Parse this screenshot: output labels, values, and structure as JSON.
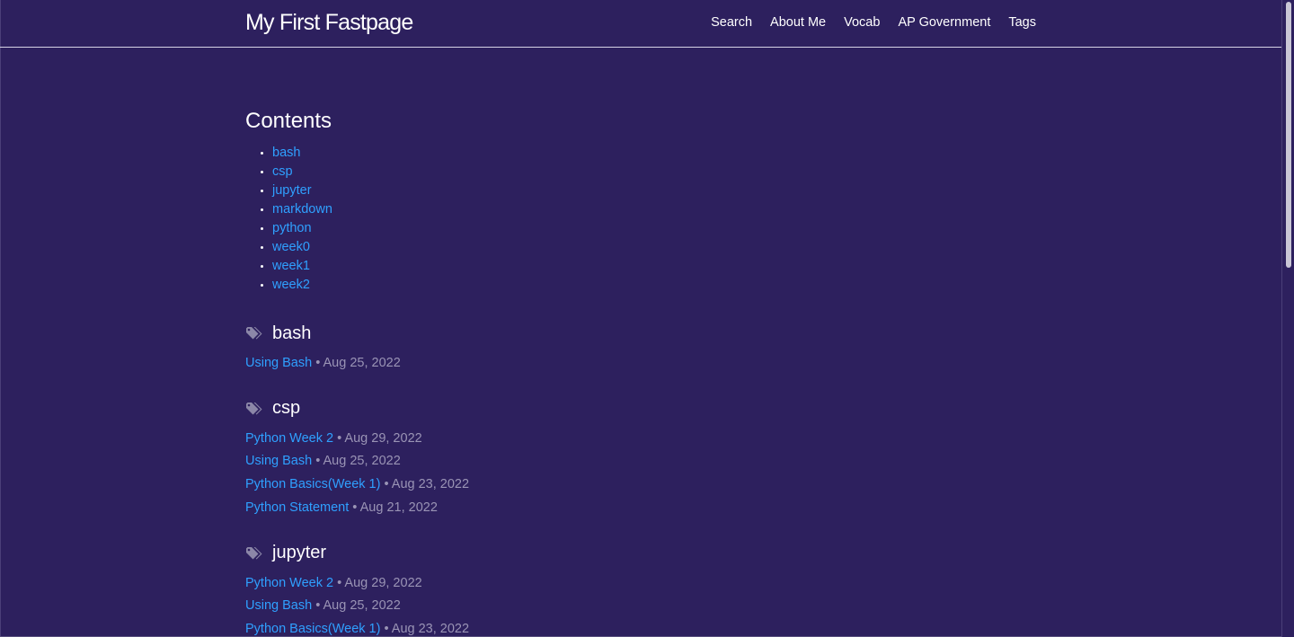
{
  "header": {
    "title": "My First Fastpage",
    "nav": [
      {
        "label": "Search"
      },
      {
        "label": "About Me"
      },
      {
        "label": "Vocab"
      },
      {
        "label": "AP Government"
      },
      {
        "label": "Tags"
      }
    ]
  },
  "main": {
    "contents_title": "Contents",
    "toc": [
      {
        "label": "bash"
      },
      {
        "label": "csp"
      },
      {
        "label": "jupyter"
      },
      {
        "label": "markdown"
      },
      {
        "label": "python"
      },
      {
        "label": "week0"
      },
      {
        "label": "week1"
      },
      {
        "label": "week2"
      }
    ],
    "sections": [
      {
        "tag": "bash",
        "posts": [
          {
            "title": "Using Bash",
            "date": "Aug 25, 2022"
          }
        ]
      },
      {
        "tag": "csp",
        "posts": [
          {
            "title": "Python Week 2",
            "date": "Aug 29, 2022"
          },
          {
            "title": "Using Bash",
            "date": "Aug 25, 2022"
          },
          {
            "title": "Python Basics(Week 1)",
            "date": "Aug 23, 2022"
          },
          {
            "title": "Python Statement",
            "date": "Aug 21, 2022"
          }
        ]
      },
      {
        "tag": "jupyter",
        "posts": [
          {
            "title": "Python Week 2",
            "date": "Aug 29, 2022"
          },
          {
            "title": "Using Bash",
            "date": "Aug 25, 2022"
          },
          {
            "title": "Python Basics(Week 1)",
            "date": "Aug 23, 2022"
          }
        ]
      }
    ],
    "separator": "•"
  },
  "icons": {
    "tag": "tag-icon"
  },
  "colors": {
    "background": "#2d205e",
    "link": "#2fa0ff",
    "date": "#9a94b5",
    "text": "#ffffff"
  }
}
